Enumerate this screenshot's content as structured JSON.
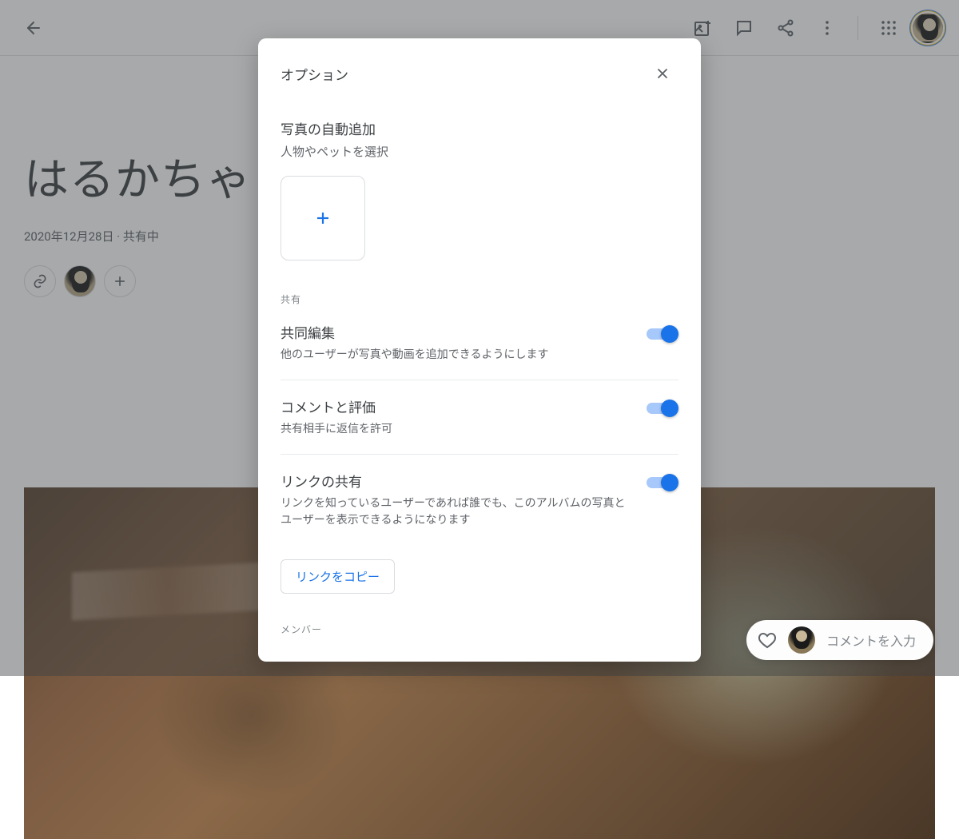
{
  "header": {
    "icons": {
      "back": "back-icon",
      "add_photo": "add-photo-icon",
      "comment": "comment-icon",
      "share": "share-icon",
      "more": "more-icon",
      "apps": "apps-icon"
    }
  },
  "album": {
    "title": "はるかちゃ",
    "date": "2020年12月28日",
    "status": "共有中",
    "meta_separator": " · "
  },
  "dialog": {
    "title": "オプション",
    "auto_add": {
      "title": "写真の自動追加",
      "subtitle": "人物やペットを選択"
    },
    "share_section_label": "共有",
    "toggles": [
      {
        "title": "共同編集",
        "desc": "他のユーザーが写真や動画を追加できるようにします",
        "on": true
      },
      {
        "title": "コメントと評価",
        "desc": "共有相手に返信を許可",
        "on": true
      },
      {
        "title": "リンクの共有",
        "desc": "リンクを知っているユーザーであれば誰でも、このアルバムの写真とユーザーを表示できるようになります",
        "on": true
      }
    ],
    "copy_link_label": "リンクをコピー",
    "members_label": "メンバー"
  },
  "comment_bar": {
    "placeholder": "コメントを入力"
  },
  "colors": {
    "accent": "#1a73e8",
    "text_primary": "#3c4043",
    "text_secondary": "#5f6368"
  }
}
